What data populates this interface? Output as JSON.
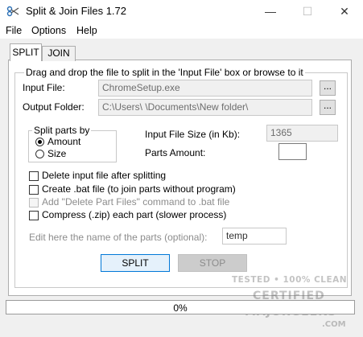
{
  "window": {
    "title": "Split & Join Files 1.72",
    "minimize_glyph": "—",
    "maximize_glyph": "☐",
    "close_glyph": "✕"
  },
  "menu": {
    "items": [
      "File",
      "Options",
      "Help"
    ]
  },
  "tabs": [
    {
      "label": "SPLIT",
      "active": true
    },
    {
      "label": "JOIN",
      "active": false
    }
  ],
  "split": {
    "group_label": "Drag and drop the file to split in the 'Input File' box or browse to it",
    "input_file_label": "Input File:",
    "input_file_value": "ChromeSetup.exe",
    "output_folder_label": "Output Folder:",
    "output_folder_value": "C:\\Users\\      \\Documents\\New folder\\",
    "browse_label": "...",
    "split_by": {
      "label": "Split parts by",
      "options": [
        {
          "label": "Amount",
          "selected": true
        },
        {
          "label": "Size",
          "selected": false
        }
      ]
    },
    "input_size_label": "Input File Size (in Kb):",
    "input_size_value": "1365",
    "parts_amount_label": "Parts Amount:",
    "parts_amount_value": "",
    "checkboxes": [
      {
        "label": "Delete input file after splitting",
        "checked": false,
        "enabled": true
      },
      {
        "label": "Create .bat file (to join parts without program)",
        "checked": false,
        "enabled": true
      },
      {
        "label": "Add \"Delete Part Files\" command to .bat file",
        "checked": false,
        "enabled": false
      },
      {
        "label": "Compress (.zip) each part (slower process)",
        "checked": false,
        "enabled": true
      }
    ],
    "parts_name_label": "Edit here the name of the parts (optional):",
    "parts_name_value": "temp",
    "split_button": "SPLIT",
    "stop_button": "STOP"
  },
  "progress": {
    "text": "0%",
    "fraction": 0
  },
  "watermark": {
    "line1": "TESTED • 100% CLEAN",
    "line2": "CERTIFIED",
    "line3": "MAJORGEEKS",
    "line4": ".COM"
  },
  "colors": {
    "accent": "#0078d7",
    "disabled": "#8c8c8c"
  },
  "icons": {
    "app": "scissors-icon"
  }
}
